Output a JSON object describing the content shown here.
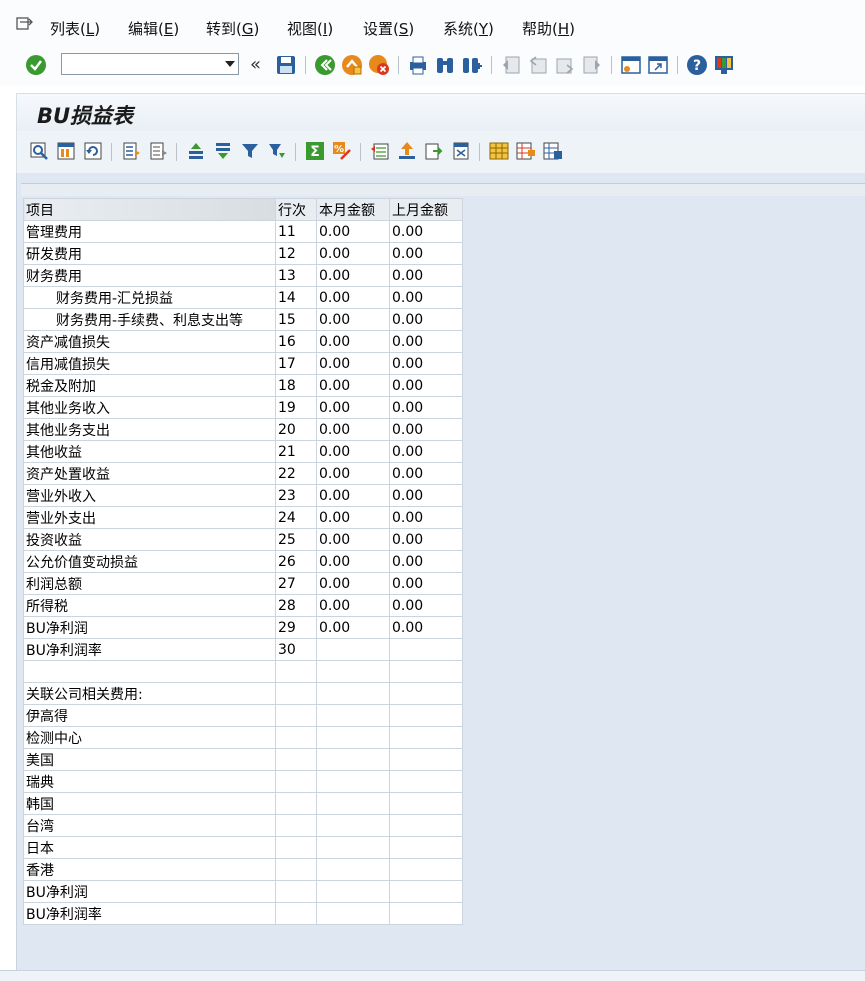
{
  "menu": {
    "items": [
      {
        "label": "列表",
        "accel": "L"
      },
      {
        "label": "编辑",
        "accel": "E"
      },
      {
        "label": "转到",
        "accel": "G"
      },
      {
        "label": "视图",
        "accel": "I"
      },
      {
        "label": "设置",
        "accel": "S"
      },
      {
        "label": "系统",
        "accel": "Y"
      },
      {
        "label": "帮助",
        "accel": "H"
      }
    ]
  },
  "toolbar": {
    "command_value": "",
    "collapse_glyph": "«"
  },
  "page": {
    "title": "BU损益表"
  },
  "table": {
    "headers": [
      "项目",
      "行次",
      "本月金额",
      "上月金额"
    ],
    "rows": [
      [
        "管理费用",
        "11",
        "0.00",
        "0.00"
      ],
      [
        "研发费用",
        "12",
        "0.00",
        "0.00"
      ],
      [
        "财务费用",
        "13",
        "0.00",
        "0.00"
      ],
      [
        "财务费用-汇兑损益",
        "14",
        "0.00",
        "0.00"
      ],
      [
        "财务费用-手续费、利息支出等",
        "15",
        "0.00",
        "0.00"
      ],
      [
        "资产减值损失",
        "16",
        "0.00",
        "0.00"
      ],
      [
        "信用减值损失",
        "17",
        "0.00",
        "0.00"
      ],
      [
        "税金及附加",
        "18",
        "0.00",
        "0.00"
      ],
      [
        "其他业务收入",
        "19",
        "0.00",
        "0.00"
      ],
      [
        "其他业务支出",
        "20",
        "0.00",
        "0.00"
      ],
      [
        "其他收益",
        "21",
        "0.00",
        "0.00"
      ],
      [
        "资产处置收益",
        "22",
        "0.00",
        "0.00"
      ],
      [
        "营业外收入",
        "23",
        "0.00",
        "0.00"
      ],
      [
        "营业外支出",
        "24",
        "0.00",
        "0.00"
      ],
      [
        "投资收益",
        "25",
        "0.00",
        "0.00"
      ],
      [
        "公允价值变动损益",
        "26",
        "0.00",
        "0.00"
      ],
      [
        "利润总额",
        "27",
        "0.00",
        "0.00"
      ],
      [
        "所得税",
        "28",
        "0.00",
        "0.00"
      ],
      [
        "BU净利润",
        "29",
        "0.00",
        "0.00"
      ],
      [
        "BU净利润率",
        "30",
        "",
        ""
      ],
      [
        "",
        "",
        "",
        ""
      ],
      [
        "关联公司相关费用:",
        "",
        "",
        ""
      ],
      [
        "伊高得",
        "",
        "",
        ""
      ],
      [
        "检测中心",
        "",
        "",
        ""
      ],
      [
        "美国",
        "",
        "",
        ""
      ],
      [
        "瑞典",
        "",
        "",
        ""
      ],
      [
        "韩国",
        "",
        "",
        ""
      ],
      [
        "台湾",
        "",
        "",
        ""
      ],
      [
        "日本",
        "",
        "",
        ""
      ],
      [
        "香港",
        "",
        "",
        ""
      ],
      [
        "BU净利润",
        "",
        "",
        ""
      ],
      [
        "BU净利润率",
        "",
        "",
        ""
      ]
    ],
    "indented_rows": [
      3,
      4
    ]
  },
  "colors": {
    "accent_green": "#3a9a2f",
    "accent_orange": "#e8891c",
    "accent_red": "#d9381e",
    "icon_blue": "#2b5f9e"
  }
}
